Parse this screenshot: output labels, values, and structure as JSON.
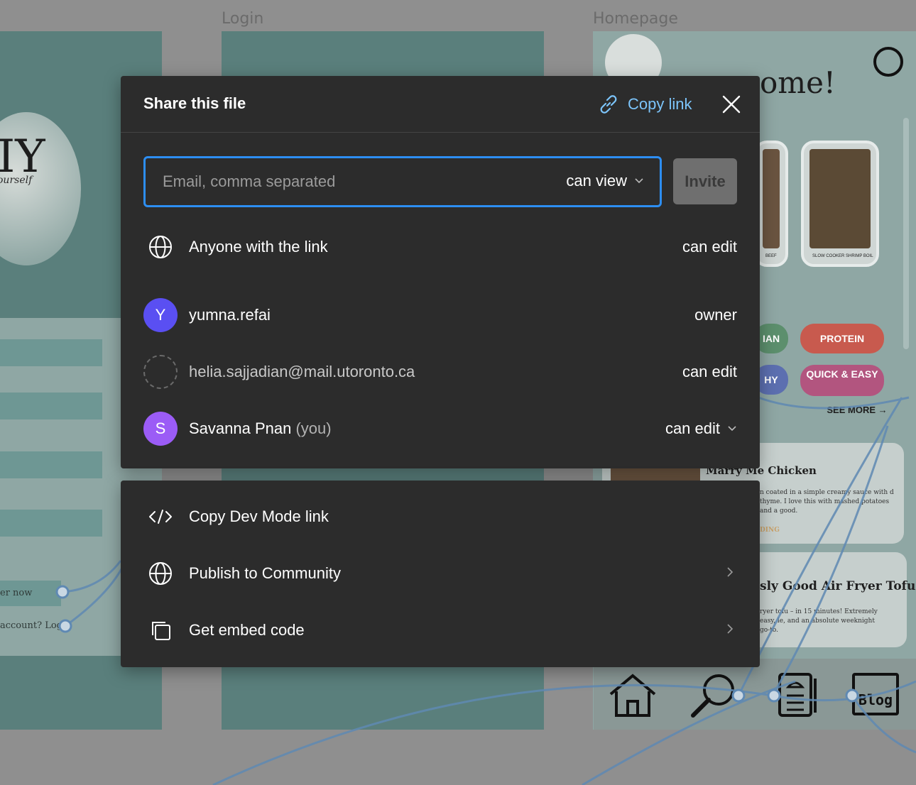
{
  "background": {
    "frame_titles": [
      "Login",
      "Homepage"
    ],
    "logo_text": "IY",
    "logo_subtext": "ourself",
    "welcome_text": "ome!",
    "login_links": [
      "er now",
      "account? Log"
    ],
    "recipe_cards": [
      {
        "caption": "BEEF"
      },
      {
        "caption": "SLOW COOKER SHRIMP BOIL"
      }
    ],
    "tags": [
      {
        "label": "IAN",
        "color": "#5c8f6d"
      },
      {
        "label": "PROTEIN",
        "color": "#c85a4e"
      },
      {
        "label": "HY",
        "color": "#5c6fb0"
      },
      {
        "label": "QUICK & EASY",
        "color": "#b2557f"
      }
    ],
    "see_more": "SEE MORE →",
    "recipes": [
      {
        "title": "Marry Me Chicken",
        "desc": "n coated in a simple creamy sauce with d thyme. I love this with mashed potatoes and a good.",
        "tag": "DING"
      },
      {
        "title": "sly Good Air Fryer Tofu",
        "desc": "ryer tofu – in 15 minutes! Extremely easy, le, and an absolute weeknight go-to."
      }
    ],
    "nav_blog_label": "Blog"
  },
  "share": {
    "title": "Share this file",
    "copy_link_label": "Copy link",
    "invite_placeholder": "Email, comma separated",
    "invite_permission": "can view",
    "invite_button": "Invite",
    "link_access": {
      "label": "Anyone with the link",
      "permission": "can edit"
    },
    "people": [
      {
        "initial": "Y",
        "name": "yumna.refai",
        "suffix": "",
        "permission": "owner",
        "avatar_color": "#5a4ff2"
      },
      {
        "initial": "",
        "name": "helia.sajjadian@mail.utoronto.ca",
        "suffix": "",
        "permission": "can edit",
        "avatar_color": ""
      },
      {
        "initial": "S",
        "name": "Savanna Pnan",
        "suffix": "(you)",
        "permission": "can edit",
        "avatar_color": "#9b5cf6"
      }
    ]
  },
  "options": {
    "items": [
      {
        "label": "Copy Dev Mode link",
        "icon": "code-icon"
      },
      {
        "label": "Publish to Community",
        "icon": "globe-icon"
      },
      {
        "label": "Get embed code",
        "icon": "embed-icon"
      }
    ]
  },
  "colors": {
    "modal_bg": "#2c2c2c",
    "accent_blue": "#7cc4fa",
    "focus_border": "#2d8ef2"
  }
}
